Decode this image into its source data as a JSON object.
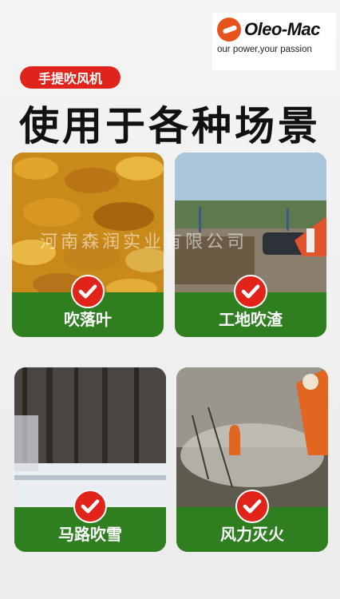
{
  "brand": {
    "name": "Oleo-Mac",
    "slogan": "our power,your passion"
  },
  "badge": "手提吹风机",
  "headline": "使用于各种场景",
  "watermark": "河南森润实业有限公司",
  "cards": [
    {
      "label": "吹落叶",
      "icon": "check-icon"
    },
    {
      "label": "工地吹渣",
      "icon": "check-icon"
    },
    {
      "label": "马路吹雪",
      "icon": "check-icon"
    },
    {
      "label": "风力灭火",
      "icon": "check-icon"
    }
  ],
  "colors": {
    "accent_red": "#e2231a",
    "label_green": "#2f7f21",
    "brand_orange": "#e8521c"
  }
}
